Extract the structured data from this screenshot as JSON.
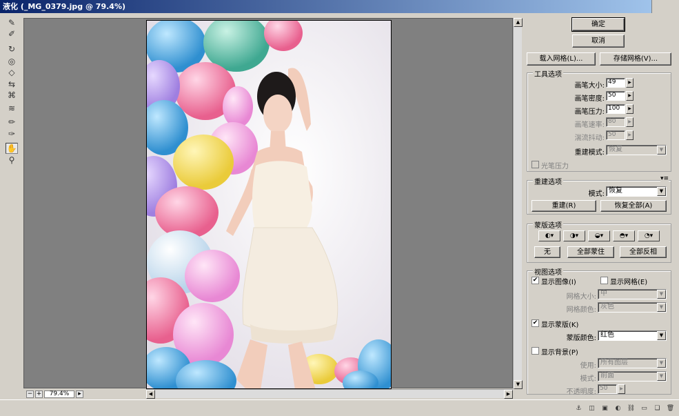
{
  "window": {
    "title": "液化 (_MG_0379.jpg @ 79.4%)"
  },
  "zoom": {
    "value": "79.4%",
    "minus": "−",
    "plus": "+"
  },
  "buttons": {
    "ok": "确定",
    "cancel": "取消",
    "load_mesh": "载入网格(L)...",
    "save_mesh": "存储网格(V)..."
  },
  "tool_options": {
    "title": "工具选项",
    "brush_size_label": "画笔大小:",
    "brush_size": "49",
    "brush_density_label": "画笔密度:",
    "brush_density": "50",
    "brush_pressure_label": "画笔压力:",
    "brush_pressure": "100",
    "brush_rate_label": "画笔速率:",
    "brush_rate": "80",
    "turbulent_jitter_label": "湍流抖动:",
    "turbulent_jitter": "50",
    "reconstruct_mode_label": "重建模式:",
    "reconstruct_mode": "恢复",
    "stylus_pressure": "光笔压力"
  },
  "reconstruct_options": {
    "title": "重建选项",
    "mode_label": "模式:",
    "mode": "恢复",
    "reconstruct_btn": "重建(R)",
    "restore_all_btn": "恢复全部(A)"
  },
  "mask_options": {
    "title": "蒙版选项",
    "none_btn": "无",
    "mask_all_btn": "全部蒙住",
    "invert_all_btn": "全部反相"
  },
  "view_options": {
    "title": "视图选项",
    "show_image": "显示图像(I)",
    "show_mesh": "显示网格(E)",
    "mesh_size_label": "网格大小:",
    "mesh_size": "中",
    "mesh_color_label": "网格颜色:",
    "mesh_color": "灰色",
    "show_mask": "显示蒙版(K)",
    "mask_color_label": "蒙版颜色:",
    "mask_color": "红色",
    "show_backdrop": "显示背景(P)",
    "use_label": "使用:",
    "use": "所有图层",
    "mode_label": "模式:",
    "mode": "前面",
    "opacity_label": "不透明度:",
    "opacity": "50"
  }
}
